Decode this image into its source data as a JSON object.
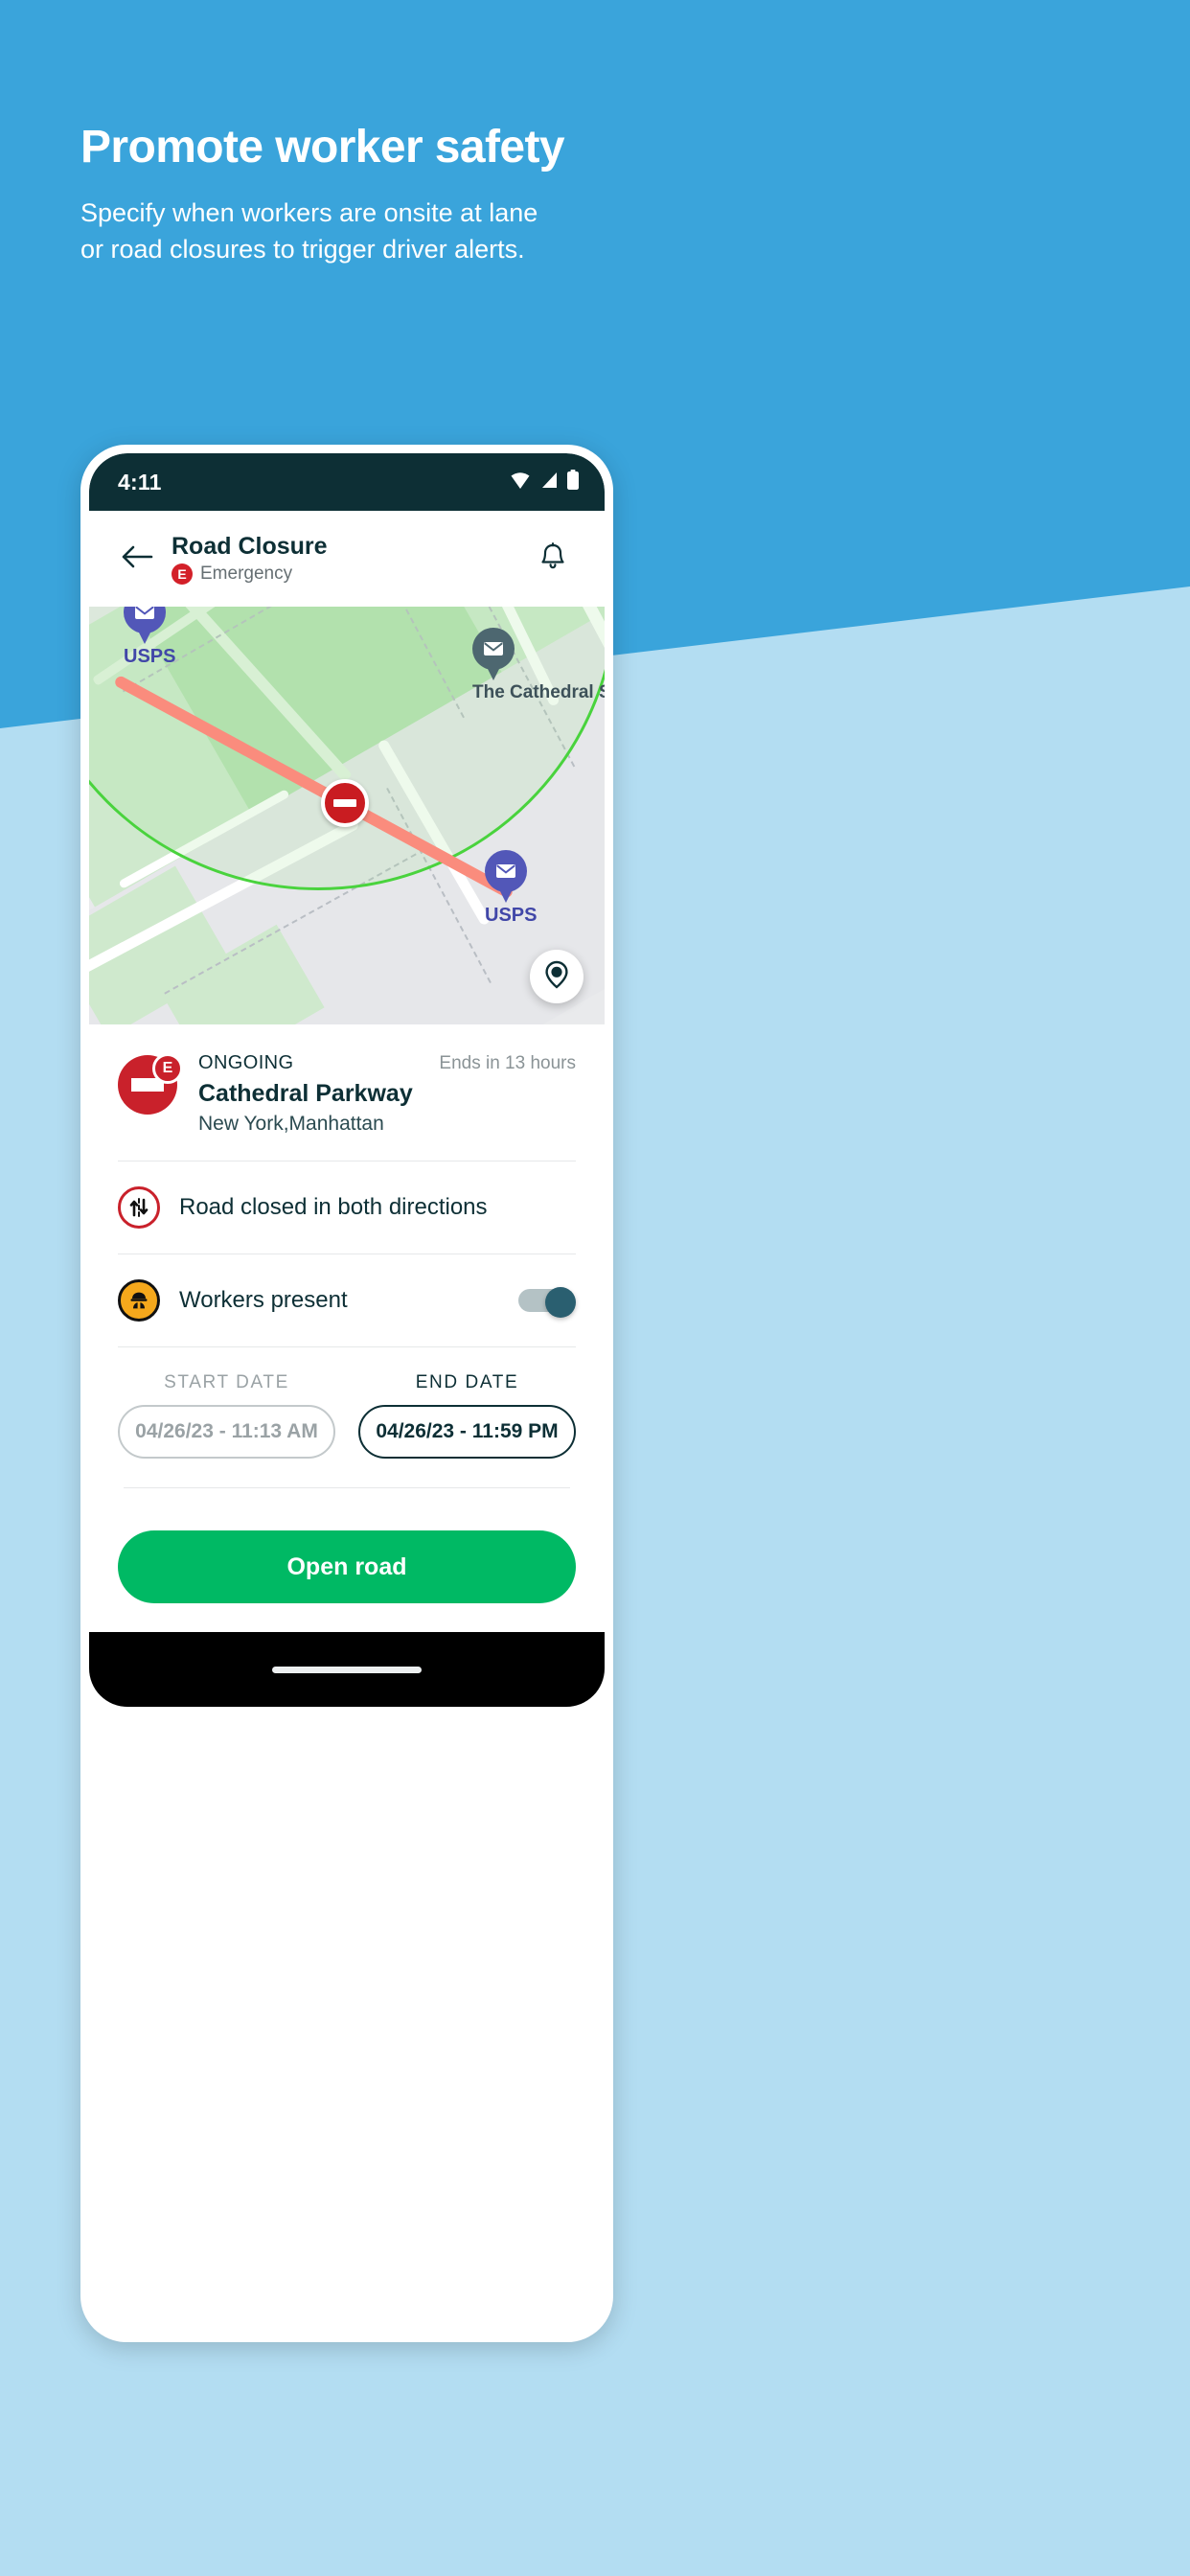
{
  "promo": {
    "title": "Promote worker safety",
    "subtitle_line1": "Specify when workers are onsite at lane",
    "subtitle_line2": "or road closures to trigger driver alerts.",
    "bg_top_color": "#3aa4db",
    "bg_bottom_color": "#b3ddf2"
  },
  "phone": {
    "status_bar": {
      "time": "4:11",
      "icons": [
        "wifi-icon",
        "cellular-signal-icon",
        "battery-icon"
      ],
      "background_color": "#0d2f35"
    },
    "app_bar": {
      "back_icon": "arrow-left-icon",
      "title": "Road Closure",
      "badge_letter": "E",
      "badge_color": "#d32029",
      "subtitle": "Emergency",
      "notification_icon": "bell-icon"
    },
    "map": {
      "markers": [
        {
          "label": "USPS",
          "icon": "mail-pin-icon",
          "color": "#5257b8"
        },
        {
          "label": "The Cathedral S",
          "icon": "mail-pin-icon",
          "color": "#4d6770"
        },
        {
          "label": "USPS",
          "icon": "mail-pin-icon",
          "color": "#5257b8"
        }
      ],
      "closure_marker_icon": "no-entry-icon",
      "closure_line_color": "#fa8c7d",
      "geofence_color": "#49d33d",
      "locate_button_icon": "my-location-icon"
    },
    "closure": {
      "status": "ONGOING",
      "name": "Cathedral Parkway",
      "location": "New York,Manhattan",
      "ends_in": "Ends in 13 hours",
      "badge_letter": "E",
      "icon": "road-closed-icon",
      "icon_color": "#c9212b"
    },
    "direction_row": {
      "icon": "both-directions-icon",
      "label": "Road closed in both directions"
    },
    "workers_row": {
      "icon": "worker-helmet-icon",
      "label": "Workers present",
      "toggle_state": "on",
      "toggle_color": "#2a5f70"
    },
    "dates": {
      "start_caption": "START DATE",
      "start_value": "04/26/23 - 11:13 AM",
      "end_caption": "END DATE",
      "end_value": "04/26/23 - 11:59 PM"
    },
    "cta": {
      "label": "Open road",
      "color": "#00b964"
    },
    "nav_bar": {
      "home_indicator": "home-indicator"
    }
  }
}
